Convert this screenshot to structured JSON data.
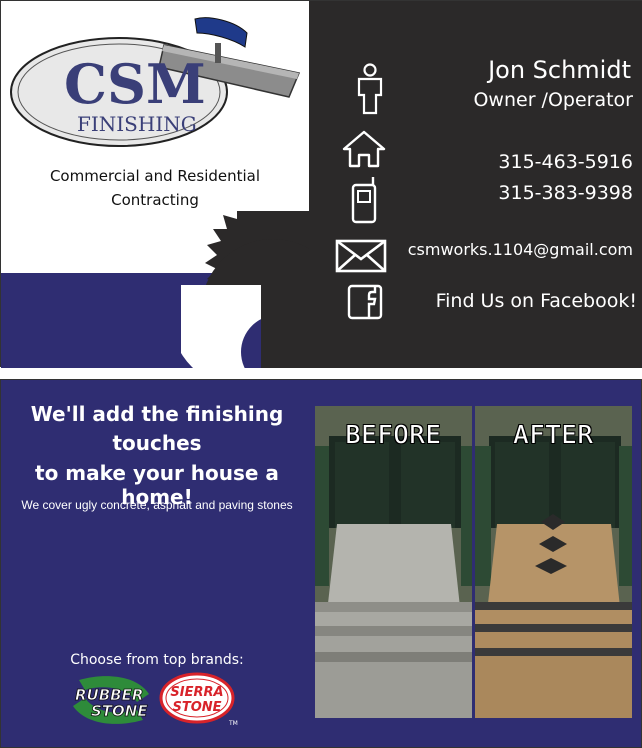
{
  "front": {
    "logo": {
      "initials": "CSM",
      "word": "FINISHING"
    },
    "tagline_line1": "Commercial and Residential",
    "tagline_line2": "Contracting",
    "name": "Jon Schmidt",
    "role": "Owner /Operator",
    "phone1": "315-463-5916",
    "phone2": "315-383-9398",
    "email": "csmworks.1104@gmail.com",
    "facebook": "Find Us on Facebook!",
    "icons": [
      "person-icon",
      "home-icon",
      "mobile-phone-icon",
      "envelope-icon",
      "facebook-icon"
    ]
  },
  "back": {
    "headline_line1": "We'll add the finishing",
    "headline_line2": "touches",
    "headline_line3": "to make your house a home!",
    "subline": "We cover ugly concrete, asphalt and paving stones",
    "brands_label": "Choose from top brands:",
    "brand1": {
      "line1": "RUBBER",
      "line2": "STONE"
    },
    "brand2": {
      "line1": "SIERRA",
      "line2": "STONE",
      "mark": "TM"
    },
    "before_label": "BEFORE",
    "after_label": "AFTER"
  },
  "colors": {
    "navy": "#2f2d72",
    "charcoal": "#2b2929",
    "logo_blue": "#3a3f78",
    "sierra_red": "#d8232a",
    "rubber_green": "#2e8b3a"
  }
}
